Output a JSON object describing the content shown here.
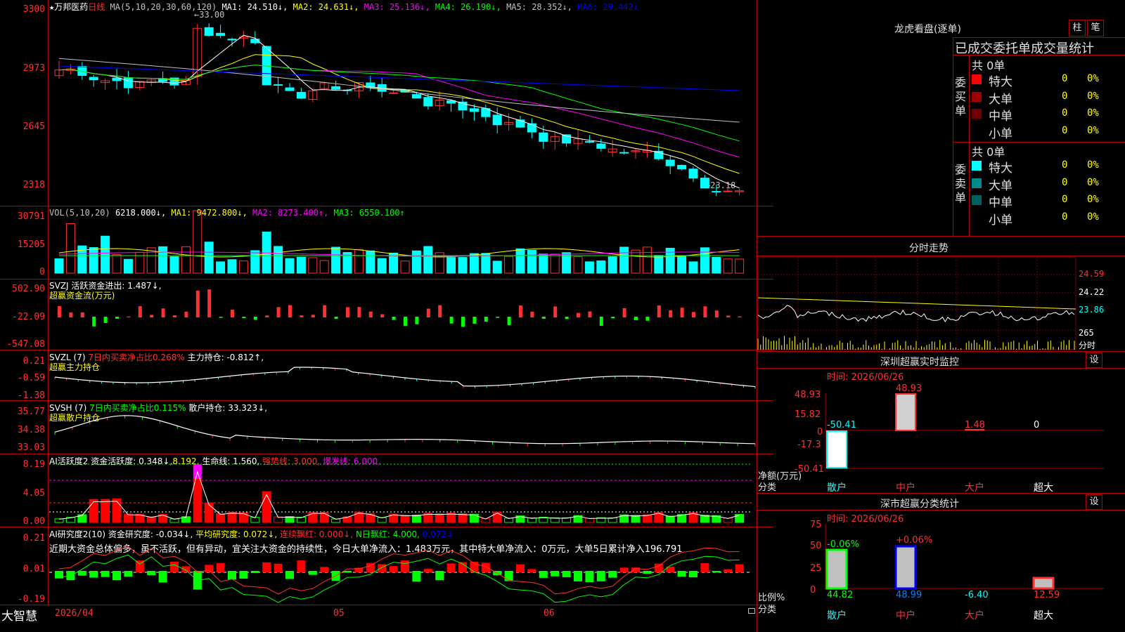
{
  "stock": {
    "star": "★",
    "name": "万邦医药",
    "period": "日线",
    "ma_label": "MA(5,10,20,30,60,120)",
    "ma": [
      {
        "text": "MA1: 24.510↓,",
        "color": "#ffffff"
      },
      {
        "text": "MA2: 24.631↓,",
        "color": "#ffff00"
      },
      {
        "text": "MA3: 25.136↓,",
        "color": "#ff00ff"
      },
      {
        "text": "MA4: 26.190↓,",
        "color": "#00ff00"
      },
      {
        "text": "MA5: 28.352↓,",
        "color": "#c0c0c0"
      },
      {
        "text": "MA6: 29.442↓",
        "color": "#0000ff"
      }
    ],
    "y_labels": [
      "3300",
      "2973",
      "2645",
      "2318"
    ],
    "high_label": "←33.00",
    "low_label": "←23.18"
  },
  "volume": {
    "header": "VOL(5,10,20)",
    "value": "6218.000↓,",
    "ma1": "MA1: 9472.800↓,",
    "ma2": "MA2: 8273.400↑,",
    "ma3": "MA3: 6550.100↑",
    "y_labels": [
      "30791",
      "15205",
      "0"
    ]
  },
  "svzj": {
    "header": "SVZJ  活跃资金进出: 1.487↓,",
    "sub": "超赢资金流(万元)",
    "y_labels": [
      "502.90",
      "-22.09",
      "-547.08"
    ]
  },
  "svzl": {
    "header_a": "SVZL (7)",
    "header_b": "7日内买卖净占比0.268%",
    "header_c": "主力持仓: -0.812↑,",
    "sub": "超赢主力持仓",
    "y_labels": [
      "0.21",
      "-0.59",
      "-1.38"
    ]
  },
  "svsh": {
    "header_a": "SVSH (7)",
    "header_b": "7日内买卖净占比0.115%",
    "header_c": "散户持仓: 33.323↓,",
    "sub": "超赢散户持仓",
    "y_labels": [
      "35.77",
      "34.38",
      "33.03"
    ]
  },
  "ai1": {
    "header_a": "AI活跃度2",
    "header_b": "资金活跃度: 0.348↓,",
    "header_c": "8.192,",
    "header_d": "生命线: 1.560,",
    "header_e": "强势线: 3.000,",
    "header_f": "爆发线: 6.000,",
    "y_labels": [
      "8.19",
      "4.05",
      "0.00"
    ]
  },
  "ai2": {
    "header_a": "AI研究度2(10)",
    "header_b": "资金研究度: -0.034↓,",
    "header_c": "平均研究度: 0.072↓,",
    "header_d": "连续飘红: 0.000↓,",
    "header_e": "N日飘红: 4.000,",
    "header_f": "0.072↓",
    "summary": "近期大资金总体偏多，虽不活跃，但有异动，宜关注大资金的持续性，今日大单净流入：1.483万元，其中特大单净流入：0万元，大单5日累计净入196.791",
    "y_labels": [
      "0.21",
      "0.01",
      "-0.19"
    ]
  },
  "bottom": {
    "brand": "大智慧",
    "dates": [
      "2026/04",
      "05",
      "06"
    ]
  },
  "right": {
    "title": "龙虎看盘(逐单)",
    "btn1": "柱",
    "btn2": "笔",
    "section": "已成交委托单成交量统计",
    "buy": {
      "side_label": "委买单",
      "total": "共 0单",
      "rows": [
        {
          "name": "特大",
          "count": "0",
          "pct": "0%",
          "color": "#ff0000"
        },
        {
          "name": "大单",
          "count": "0",
          "pct": "0%",
          "color": "#a00000"
        },
        {
          "name": "中单",
          "count": "0",
          "pct": "0%",
          "color": "#700000"
        },
        {
          "name": "小单",
          "count": "0",
          "pct": "0%",
          "color": ""
        }
      ]
    },
    "sell": {
      "side_label": "委卖单",
      "total": "共 0单",
      "rows": [
        {
          "name": "特大",
          "count": "0",
          "pct": "0%",
          "color": "#00ffff"
        },
        {
          "name": "大单",
          "count": "0",
          "pct": "0%",
          "color": "#008b8b"
        },
        {
          "name": "中单",
          "count": "0",
          "pct": "0%",
          "color": "#006060"
        },
        {
          "name": "小单",
          "count": "0",
          "pct": "0%",
          "color": ""
        }
      ]
    },
    "intraday": {
      "title": "分时走势",
      "y_labels": [
        "24.59",
        "24.22",
        "23.86"
      ],
      "vol_label": "265",
      "vol_unit": "分时"
    },
    "monitor": {
      "title": "深圳超赢实时监控",
      "set": "设",
      "time": "时间: 2026/06/26",
      "y_labels": [
        "48.93",
        "15.82",
        "0",
        "-17.3",
        "-50.41"
      ],
      "unit": "净额(万元)",
      "cat_label": "分类",
      "categories": [
        "散户",
        "中户",
        "大户",
        "超大"
      ],
      "values_text": [
        "-50.41",
        "48.93",
        "1.48",
        "0"
      ]
    },
    "stats": {
      "title": "深市超赢分类统计",
      "set": "设",
      "time": "时间: 2026/06/26",
      "y_labels": [
        "75",
        "50",
        "25",
        "0"
      ],
      "unit": "比例%",
      "cat_label": "分类",
      "categories": [
        "散户",
        "中户",
        "大户",
        "超大"
      ],
      "top_labels": [
        "-0.06%",
        "+0.06%"
      ],
      "bottom_values": [
        "44.82",
        "48.99",
        "-6.40",
        "12.59"
      ]
    }
  }
}
